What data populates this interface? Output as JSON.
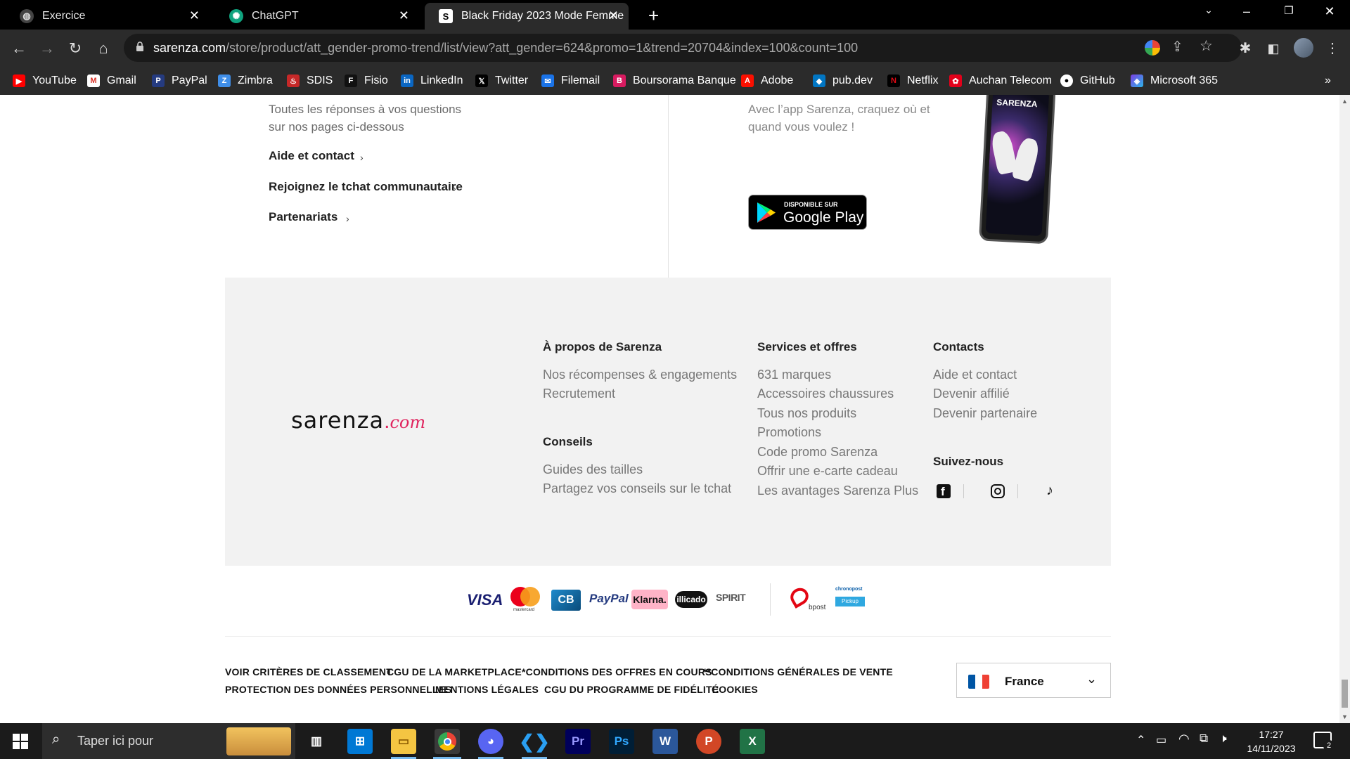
{
  "browser": {
    "tabs": [
      {
        "title": "Exercice",
        "active": false
      },
      {
        "title": "ChatGPT",
        "active": false
      },
      {
        "title": "Black Friday 2023 Mode Femme",
        "active": true
      }
    ],
    "new_tab": "+",
    "url_host": "sarenza.com",
    "url_path": "/store/product/att_gender-promo-trend/list/view?att_gender=624&promo=1&trend=20704&index=100&count=100",
    "bookmarks": [
      "YouTube",
      "Gmail",
      "PayPal",
      "Zimbra",
      "SDIS",
      "Fisio",
      "LinkedIn",
      "Twitter",
      "Filemail",
      "Boursorama Banque",
      "Adobe",
      "pub.dev",
      "Netflix",
      "Auchan Telecom",
      "GitHub",
      "Microsoft 365"
    ],
    "bookmarks_more": "»"
  },
  "help": {
    "text_line1": "Toutes les réponses à vos questions",
    "text_line2": "sur nos pages ci-dessous",
    "links": [
      "Aide et contact",
      "Rejoignez le tchat communautaire",
      "Partenariats"
    ],
    "chevron": "›"
  },
  "app": {
    "text_line1": "Avec l’app Sarenza, craquez où et",
    "text_line2": "quand vous voulez !",
    "badge_small": "DISPONIBLE SUR",
    "badge_big": "Google Play",
    "phone_brand": "SARENZA"
  },
  "footer": {
    "logo_main": "sarenza",
    "logo_dot": ".",
    "logo_com": "com",
    "about": {
      "title": "À propos de Sarenza",
      "links": [
        "Nos récompenses & engagements",
        "Recrutement"
      ]
    },
    "advice": {
      "title": "Conseils",
      "links": [
        "Guides des tailles",
        "Partagez vos conseils sur le tchat"
      ]
    },
    "services": {
      "title": "Services et offres",
      "links": [
        "631 marques",
        "Accessoires chaussures",
        "Tous nos produits",
        "Promotions",
        "Code promo Sarenza",
        "Offrir une e-carte cadeau",
        "Les avantages Sarenza Plus"
      ]
    },
    "contacts": {
      "title": "Contacts",
      "links": [
        "Aide et contact",
        "Devenir affilié",
        "Devenir partenaire"
      ]
    },
    "follow": {
      "title": "Suivez-nous"
    }
  },
  "payments": {
    "visa": "VISA",
    "mastercard": "mastercard",
    "cb": "CB",
    "paypal": "PayPal",
    "klarna": "Klarna.",
    "illicado": "illicado",
    "spirit": "SPIRIT",
    "bpost": "bpost",
    "chronopost": "chronopost",
    "pickup": "Pickup"
  },
  "legal": {
    "row1": [
      "VOIR CRITÈRES DE CLASSEMENT",
      "CGU DE LA MARKETPLACE",
      "*CONDITIONS DES OFFRES EN COURS",
      "**CONDITIONS GÉNÉRALES DE VENTE"
    ],
    "row2": [
      "PROTECTION DES DONNÉES PERSONNELLES",
      "MENTIONS LÉGALES",
      "CGU DU PROGRAMME DE FIDÉLITÉ",
      "COOKIES"
    ],
    "country": "France"
  },
  "taskbar": {
    "search_placeholder": "Taper ici pour",
    "time": "17:27",
    "date": "14/11/2023",
    "notif_count": "2"
  }
}
